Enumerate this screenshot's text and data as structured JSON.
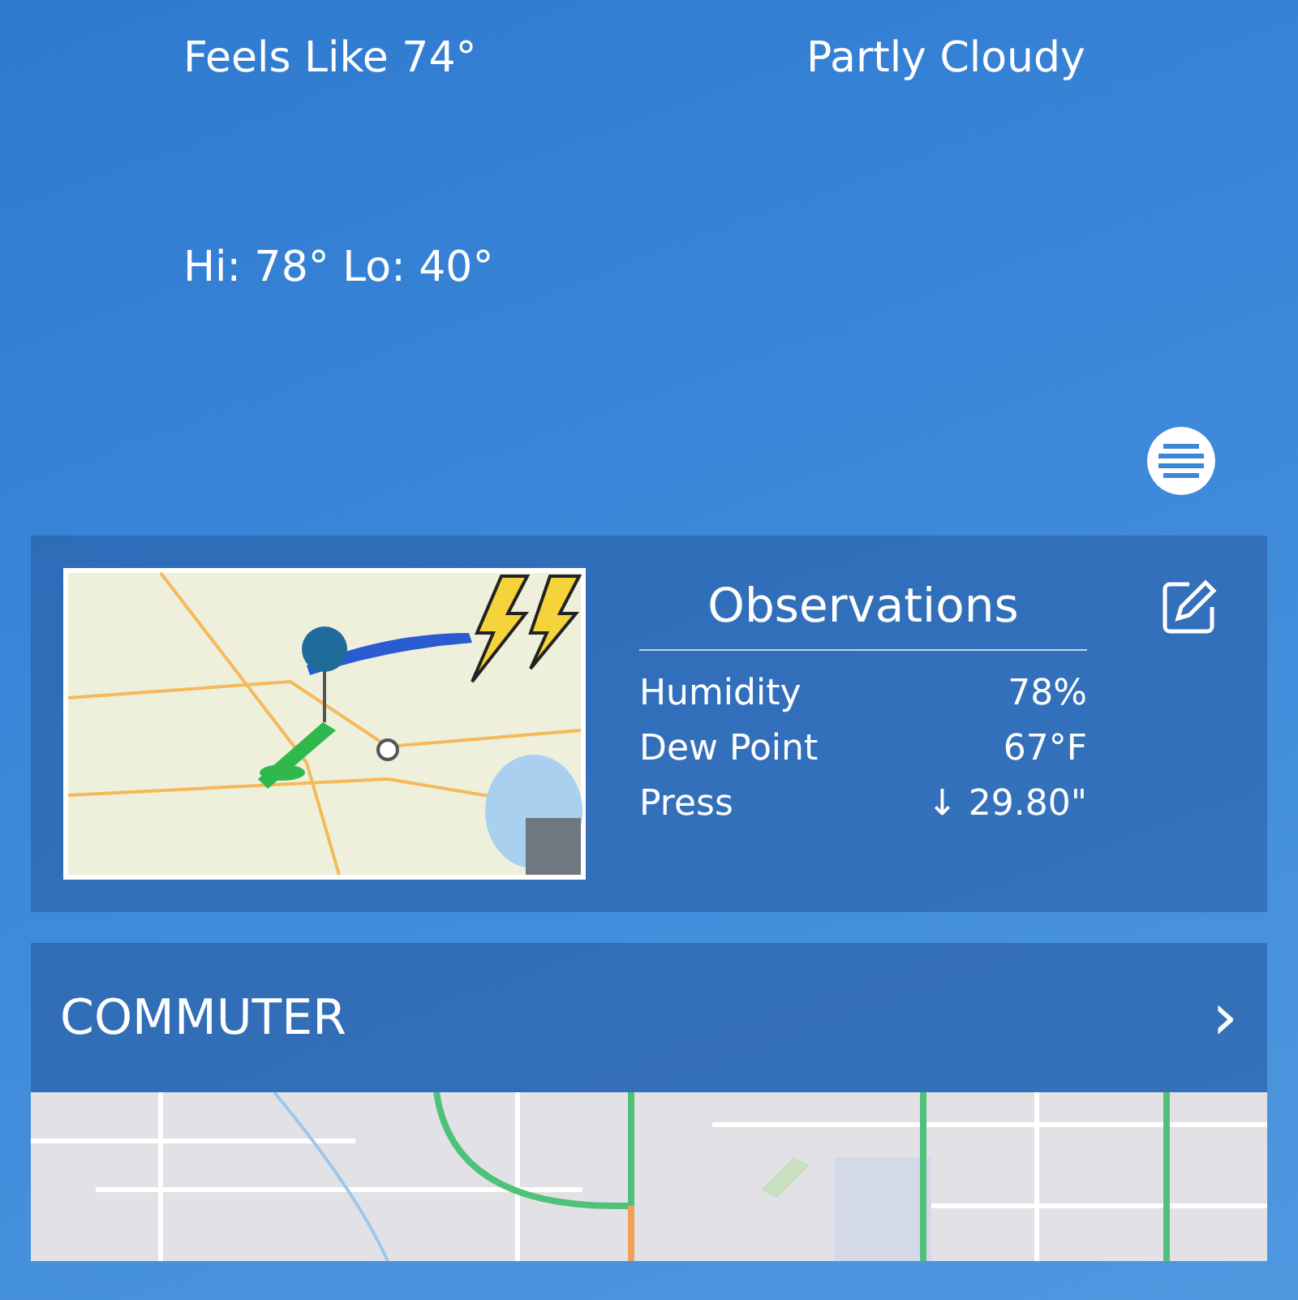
{
  "current": {
    "feels_like": "Feels  Like  74°",
    "condition": "Partly  Cloudy",
    "hi_lo": "Hi: 78° Lo: 40°"
  },
  "observations": {
    "title": "Observations",
    "rows": [
      {
        "label": "Humidity",
        "value": "78%"
      },
      {
        "label": "Dew Point",
        "value": "67°F"
      },
      {
        "label": "Press",
        "value": "↓ 29.80\""
      }
    ]
  },
  "commuter": {
    "title": "COMMUTER",
    "chevron": "›"
  }
}
